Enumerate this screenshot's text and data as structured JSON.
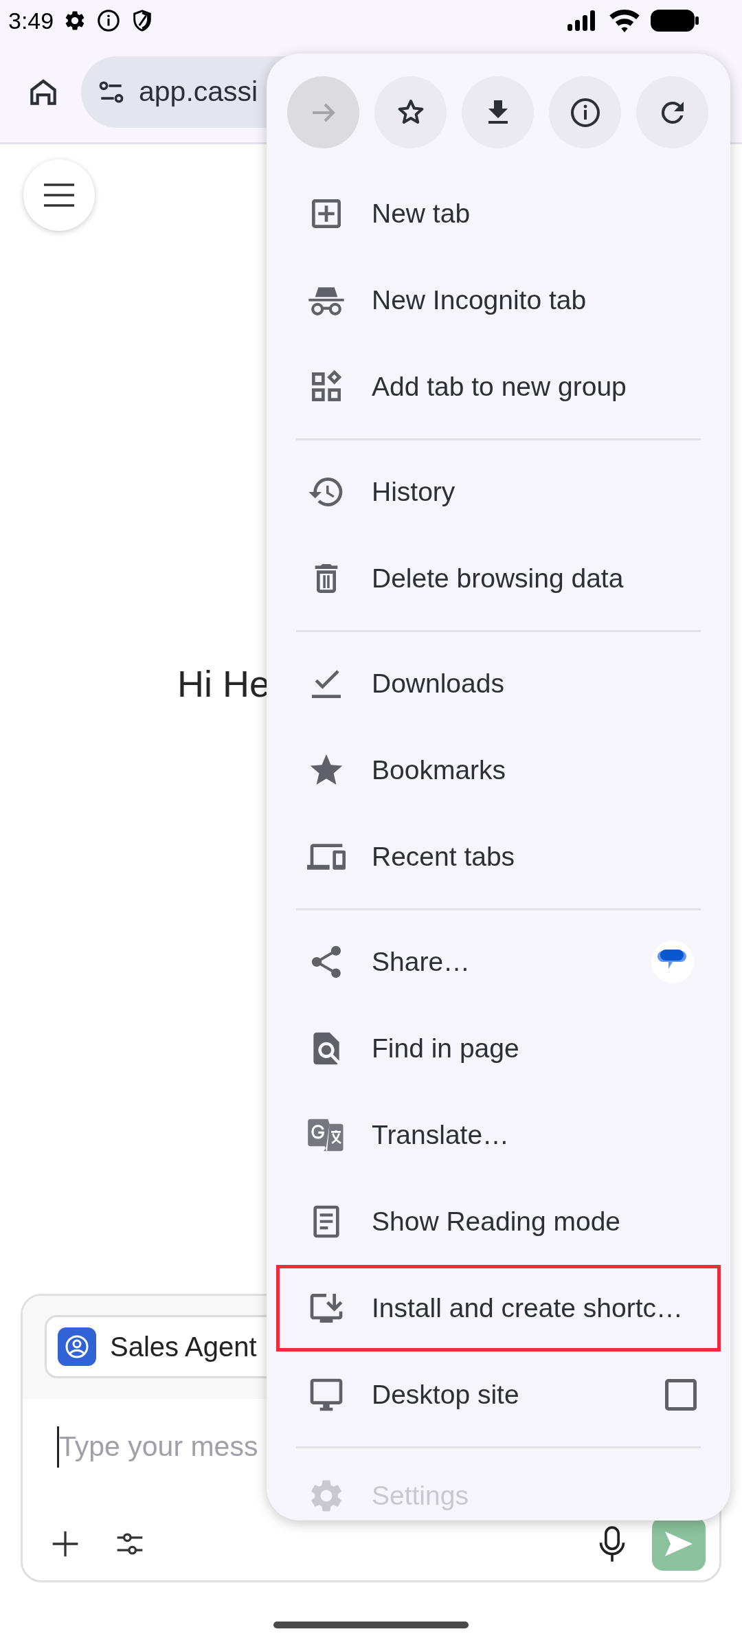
{
  "status_bar": {
    "time": "3:49"
  },
  "address_bar": {
    "url": "app.cassi"
  },
  "page": {
    "greeting": "Hi He",
    "agent_chip": {
      "label": "Sales Agent"
    },
    "message_field": {
      "placeholder": "Type your mess"
    },
    "send_button": {
      "disabled": true
    }
  },
  "menu": {
    "top_actions": [
      {
        "kind": "forward",
        "disabled": true
      },
      {
        "kind": "bookmark",
        "disabled": false
      },
      {
        "kind": "download",
        "disabled": false
      },
      {
        "kind": "info",
        "disabled": false
      },
      {
        "kind": "reload",
        "disabled": false
      }
    ],
    "sections": [
      {
        "items": [
          {
            "label": "New tab",
            "highlighted": false
          },
          {
            "label": "New Incognito tab",
            "highlighted": false
          },
          {
            "label": "Add tab to new group",
            "highlighted": false
          }
        ]
      },
      {
        "items": [
          {
            "label": "History",
            "highlighted": false
          },
          {
            "label": "Delete browsing data",
            "highlighted": false
          }
        ]
      },
      {
        "items": [
          {
            "label": "Downloads",
            "highlighted": false
          },
          {
            "label": "Bookmarks",
            "highlighted": false
          },
          {
            "label": "Recent tabs",
            "highlighted": false
          }
        ]
      },
      {
        "items": [
          {
            "label": "Share…",
            "highlighted": false
          },
          {
            "label": "Find in page",
            "highlighted": false
          },
          {
            "label": "Translate…",
            "highlighted": false
          },
          {
            "label": "Show Reading mode",
            "highlighted": false
          },
          {
            "label": "Install and create shortc…",
            "highlighted": true
          },
          {
            "label": "Desktop site",
            "highlighted": false,
            "checked": false
          }
        ]
      },
      {
        "items": [
          {
            "label": "Settings",
            "highlighted": false
          }
        ]
      }
    ]
  }
}
